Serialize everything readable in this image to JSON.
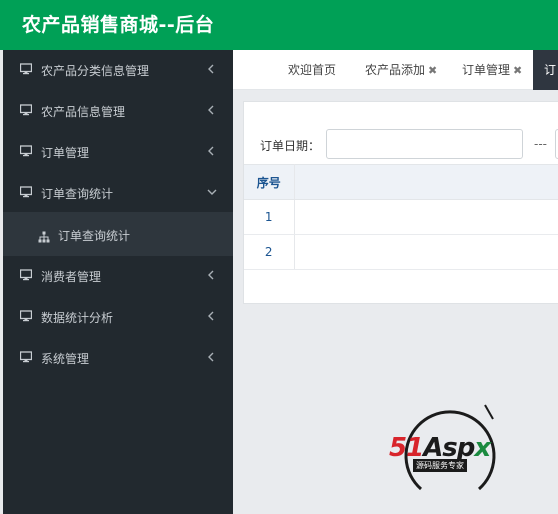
{
  "header": {
    "title": "农产品销售商城--后台",
    "bg_color": "#00a056"
  },
  "sidebar": {
    "items": [
      {
        "label": "农产品分类信息管理",
        "icon": "monitor-icon",
        "arrow": "chevron-left-icon"
      },
      {
        "label": "农产品信息管理",
        "icon": "monitor-icon",
        "arrow": "chevron-left-icon"
      },
      {
        "label": "订单管理",
        "icon": "monitor-icon",
        "arrow": "chevron-left-icon"
      },
      {
        "label": "订单查询统计",
        "icon": "monitor-icon",
        "arrow": "chevron-down-icon",
        "expanded": true
      },
      {
        "label": "消费者管理",
        "icon": "monitor-icon",
        "arrow": "chevron-left-icon"
      },
      {
        "label": "数据统计分析",
        "icon": "monitor-icon",
        "arrow": "chevron-left-icon"
      },
      {
        "label": "系统管理",
        "icon": "monitor-icon",
        "arrow": "chevron-left-icon"
      }
    ],
    "submenu": {
      "label": "订单查询统计",
      "icon": "sitemap-icon"
    }
  },
  "tabs": [
    {
      "label": "欢迎首页",
      "closable": false
    },
    {
      "label": "农产品添加",
      "closable": true,
      "close_glyph": "✖"
    },
    {
      "label": "订单管理",
      "closable": true,
      "close_glyph": "✖"
    },
    {
      "label": "订",
      "closable": false,
      "active": true
    }
  ],
  "filter": {
    "label": "订单日期：",
    "start_value": "",
    "separator": "---"
  },
  "table": {
    "headers": [
      "序号",
      ""
    ],
    "rows": [
      [
        "1",
        ""
      ],
      [
        "2",
        ""
      ]
    ]
  },
  "watermark": {
    "brand_parts": [
      "51",
      "Asp",
      "x"
    ],
    "subtitle": "源码服务专家"
  },
  "colors": {
    "sidebar": "#22292f",
    "accent": "#00a056",
    "link": "#1c5591"
  }
}
